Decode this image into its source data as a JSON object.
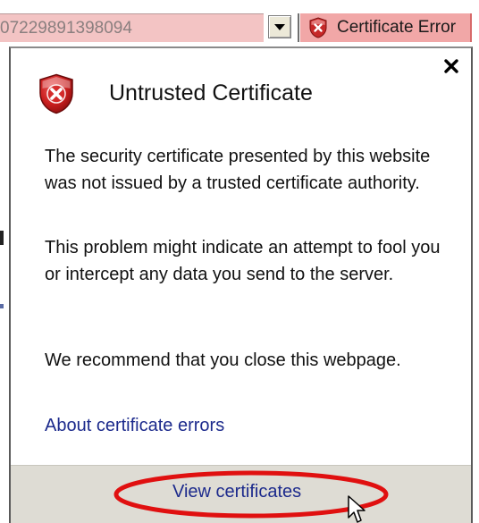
{
  "address_bar": {
    "url_fragment": "07229891398094",
    "cert_button_label": "Certificate Error",
    "colors": {
      "url_bg": "#f3c4c4",
      "cert_bg": "#f1a7a7"
    }
  },
  "popup": {
    "title": "Untrusted Certificate",
    "paragraph1": "The security certificate presented by this website was not issued by a trusted certificate authority.",
    "paragraph2": "This problem might indicate an attempt to fool you or intercept any data you send to the server.",
    "paragraph3": "We recommend that you close this webpage.",
    "about_link": "About certificate errors",
    "view_link": "View certificates",
    "icons": {
      "close": "close-icon",
      "header": "shield-error-icon",
      "cert_button": "shield-error-icon"
    },
    "colors": {
      "link": "#1c2a8c",
      "footer_bg": "#dedcd4",
      "highlight": "#e01010"
    }
  }
}
